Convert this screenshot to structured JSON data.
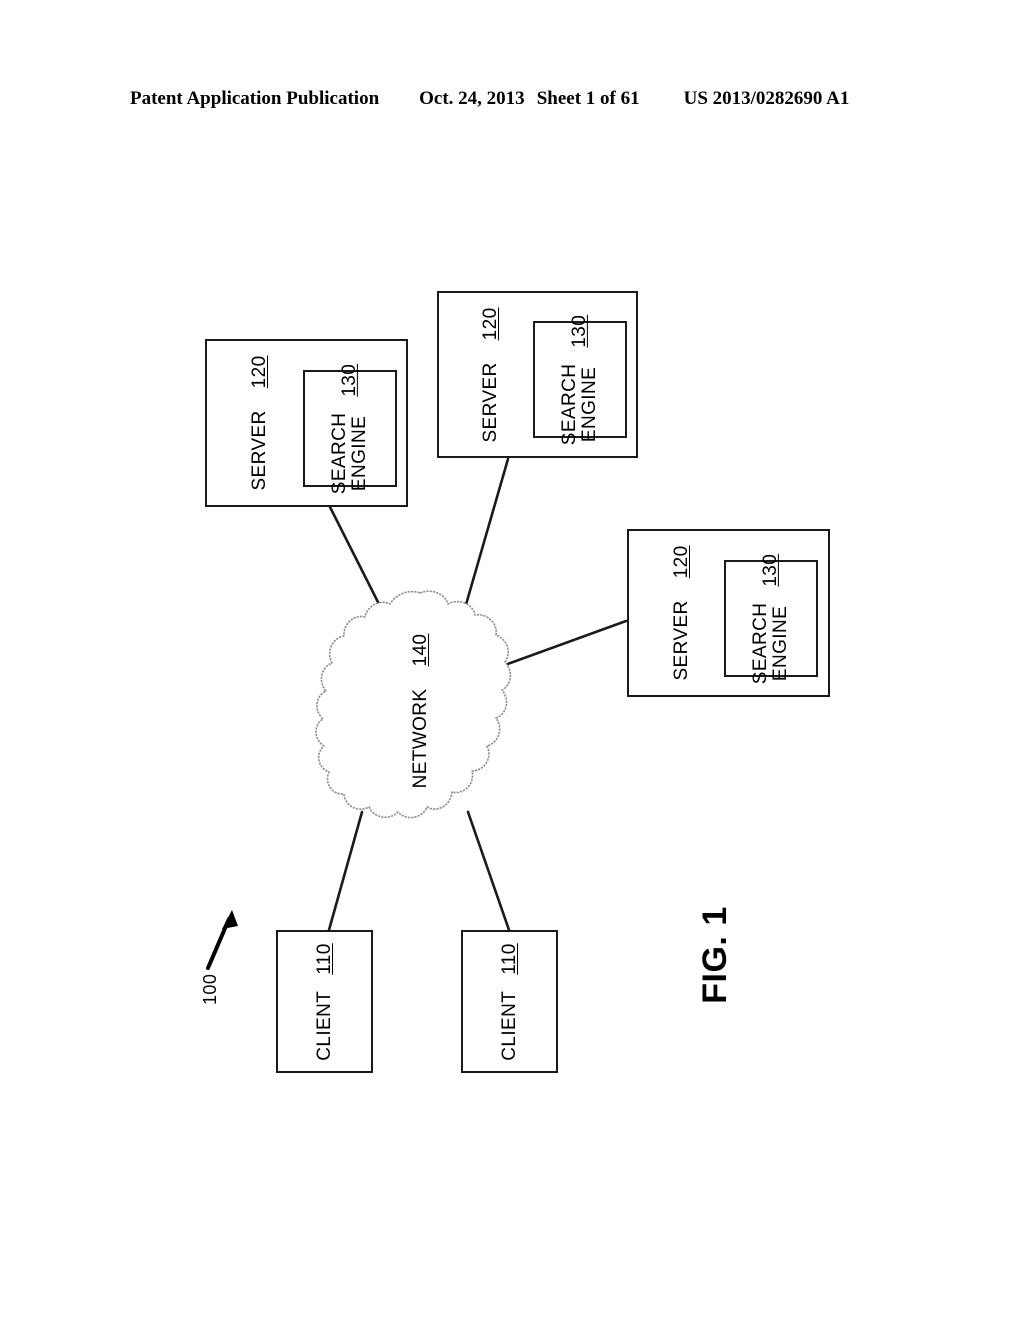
{
  "header": {
    "publication": "Patent Application Publication",
    "date": "Oct. 24, 2013",
    "sheet": "Sheet 1 of 61",
    "patent_number": "US 2013/0282690 A1"
  },
  "figure": {
    "caption": "FIG. 1",
    "system_ref": "100"
  },
  "colors": {
    "ink": "#1a1a1a",
    "cloud_outline": "#8c8c8c",
    "background": "#ffffff"
  },
  "nodes": {
    "server_1": {
      "label": "SERVER",
      "ref": "120",
      "inner": {
        "label": "SEARCH\nENGINE",
        "ref": "130"
      }
    },
    "server_2": {
      "label": "SERVER",
      "ref": "120",
      "inner": {
        "label": "SEARCH\nENGINE",
        "ref": "130"
      }
    },
    "server_3": {
      "label": "SERVER",
      "ref": "120",
      "inner": {
        "label": "SEARCH\nENGINE",
        "ref": "130"
      }
    },
    "network": {
      "label": "NETWORK",
      "ref": "140"
    },
    "client_1": {
      "label": "CLIENT",
      "ref": "110"
    },
    "client_2": {
      "label": "CLIENT",
      "ref": "110"
    }
  }
}
